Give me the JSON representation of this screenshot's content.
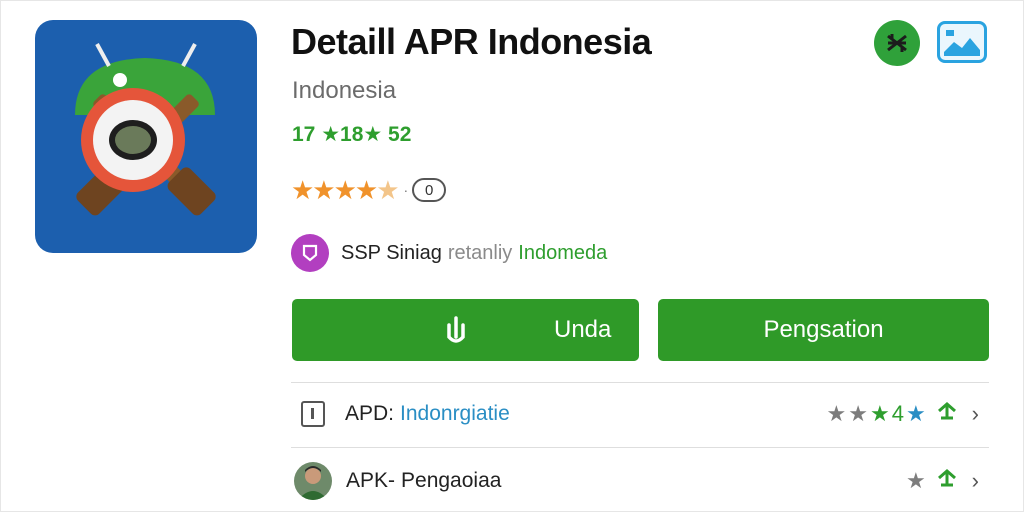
{
  "header": {
    "title": "Detaill APR Indonesia",
    "subtitle": "Indonesia",
    "stats": "17 ★18★ 52"
  },
  "rating": {
    "stars": "★★★★",
    "half": "★",
    "separator": "·",
    "count": "0"
  },
  "developer": {
    "part1": "SSP Siniag",
    "part2": "retanliy",
    "part3": "Indomeda"
  },
  "buttons": {
    "download_label": "Unda",
    "install_label": "Pengsation"
  },
  "rows": [
    {
      "label": "APD:",
      "value": "Indonrgiatie",
      "stars": [
        "★",
        "★",
        "★",
        "4",
        "★"
      ],
      "chevron": "›"
    },
    {
      "label": "APK-",
      "value": "Pengaoiaa",
      "stars": [
        "★",
        "⮍"
      ],
      "chevron": "›"
    }
  ],
  "colors": {
    "accent_green": "#2f9a28",
    "rating_orange": "#f0922b",
    "link_blue": "#2a8ec4",
    "icon_bg_blue": "#1c5fae"
  }
}
